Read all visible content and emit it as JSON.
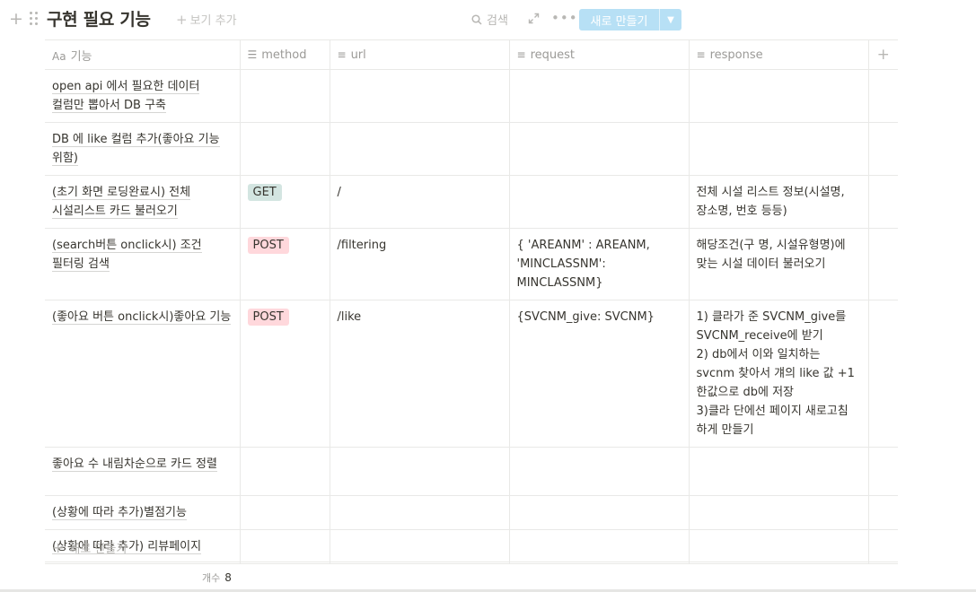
{
  "header": {
    "title": "구현 필요 기능",
    "add_view": "보기 추가",
    "search": "검색",
    "new_button": "새로 만들기"
  },
  "columns": [
    {
      "icon": "text-aa-icon",
      "label": "기능"
    },
    {
      "icon": "list-icon",
      "label": "method"
    },
    {
      "icon": "text-lines-icon",
      "label": "url"
    },
    {
      "icon": "text-lines-icon",
      "label": "request"
    },
    {
      "icon": "text-lines-icon",
      "label": "response"
    }
  ],
  "rows": [
    {
      "name": "open api 에서 필요한 데이터 컬럼만 뽑아서 DB 구축",
      "method": "",
      "url": "",
      "request": "",
      "response": ""
    },
    {
      "name": "DB 에 like 컬럼 추가(좋아요 기능 위함)",
      "method": "",
      "url": "",
      "request": "",
      "response": ""
    },
    {
      "name": "(초기 화면 로딩완료시) 전체 시설리스트 카드 불러오기",
      "method": "GET",
      "url": "/",
      "request": "",
      "response": "전체 시설 리스트 정보(시설명, 장소명, 번호 등등)"
    },
    {
      "name": "(search버튼 onclick시) 조건 필터링 검색",
      "method": "POST",
      "url": "/filtering",
      "request": "{ 'AREANM' : AREANM, 'MINCLASSNM': MINCLASSNM}",
      "response": "해당조건(구 명, 시설유형명)에 맞는 시설 데이터 불러오기"
    },
    {
      "name": "(좋아요 버튼 onclick시)좋아요 기능",
      "method": "POST",
      "url": "/like",
      "request": "{SVCNM_give: SVCNM}",
      "response": "1) 클라가 준 SVCNM_give를 SVCNM_receive에 받기\n2) db에서 이와 일치하는 svcnm 찾아서 걔의 like 값 +1 한값으로 db에 저장\n3)클라 단에선 페이지 새로고침 하게 만들기"
    },
    {
      "name": "좋아요 수 내림차순으로 카드 정렬",
      "method": "",
      "url": "",
      "request": "",
      "response": ""
    },
    {
      "name": "(상황에 따라 추가)별점기능",
      "method": "",
      "url": "",
      "request": "",
      "response": ""
    },
    {
      "name": "(상황에 따라 추가) 리뷰페이지",
      "method": "",
      "url": "",
      "request": "",
      "response": ""
    }
  ],
  "new_row_label": "새로 만들기",
  "count": {
    "label": "개수",
    "value": "8"
  },
  "colors": {
    "get_tag": "#d3e5e1",
    "post_tag": "#ffd8dc",
    "primary_button": "#b7e0f5"
  }
}
